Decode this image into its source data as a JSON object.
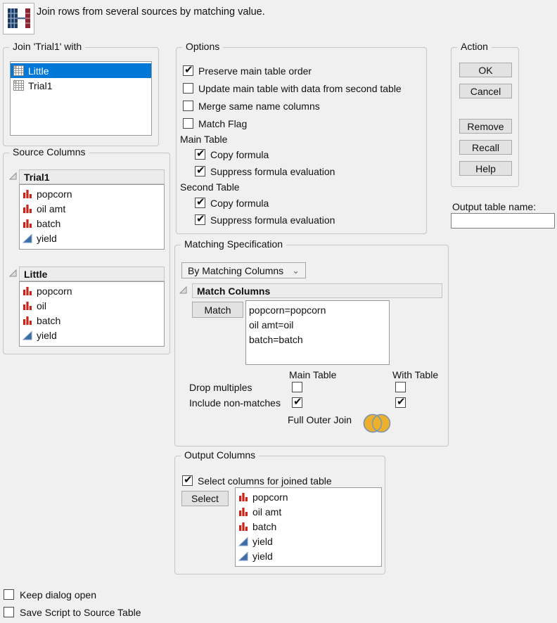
{
  "header": {
    "title": "Join rows from several sources by matching value."
  },
  "icons": {
    "chevron_down": "⌄"
  },
  "colors": {
    "sel": "#0078d7",
    "nominal": "#cb2318",
    "continuous": "#3c6da8",
    "venn": "#edb02c",
    "venn-stroke": "#7f98b2"
  },
  "join_with": {
    "label": "Join 'Trial1' with",
    "items": [
      {
        "name": "Little",
        "selected": true
      },
      {
        "name": "Trial1",
        "selected": false
      }
    ]
  },
  "source_columns": {
    "label": "Source Columns",
    "groups": [
      {
        "name": "Trial1",
        "columns": [
          {
            "name": "popcorn",
            "type": "nominal"
          },
          {
            "name": "oil amt",
            "type": "nominal"
          },
          {
            "name": "batch",
            "type": "nominal"
          },
          {
            "name": "yield",
            "type": "continuous"
          }
        ]
      },
      {
        "name": "Little",
        "columns": [
          {
            "name": "popcorn",
            "type": "nominal"
          },
          {
            "name": "oil",
            "type": "nominal"
          },
          {
            "name": "batch",
            "type": "nominal"
          },
          {
            "name": "yield",
            "type": "continuous"
          }
        ]
      }
    ]
  },
  "options": {
    "label": "Options",
    "checkboxes": [
      {
        "label": "Preserve main table order",
        "checked": true
      },
      {
        "label": "Update main table with data from second table",
        "checked": false
      },
      {
        "label": "Merge same name columns",
        "checked": false
      },
      {
        "label": "Match Flag",
        "checked": false
      }
    ],
    "main_table": {
      "label": "Main Table",
      "checkboxes": [
        {
          "label": "Copy formula",
          "checked": true
        },
        {
          "label": "Suppress formula evaluation",
          "checked": true
        }
      ]
    },
    "second_table": {
      "label": "Second Table",
      "checkboxes": [
        {
          "label": "Copy formula",
          "checked": true
        },
        {
          "label": "Suppress formula evaluation",
          "checked": true
        }
      ]
    }
  },
  "action": {
    "label": "Action",
    "buttons": [
      "OK",
      "Cancel",
      "Remove",
      "Recall",
      "Help"
    ]
  },
  "output_table": {
    "label": "Output table name:",
    "value": ""
  },
  "matching": {
    "label": "Matching Specification",
    "dropdown": "By Matching Columns",
    "match_columns_label": "Match Columns",
    "match_button": "Match",
    "pairs": [
      "popcorn=popcorn",
      "oil amt=oil",
      "batch=batch"
    ],
    "col_headers": [
      "Main Table",
      "With Table"
    ],
    "rows": [
      {
        "label": "Drop multiples",
        "main": false,
        "with": false
      },
      {
        "label": "Include non-matches",
        "main": true,
        "with": true
      }
    ],
    "join_type": "Full Outer Join"
  },
  "output_columns": {
    "label": "Output Columns",
    "select_checkbox": {
      "label": "Select columns for joined table",
      "checked": true
    },
    "select_button": "Select",
    "columns": [
      {
        "name": "popcorn",
        "type": "nominal"
      },
      {
        "name": "oil amt",
        "type": "nominal"
      },
      {
        "name": "batch",
        "type": "nominal"
      },
      {
        "name": "yield",
        "type": "continuous"
      },
      {
        "name": "yield",
        "type": "continuous"
      }
    ]
  },
  "footer": {
    "checkboxes": [
      {
        "label": "Keep dialog open",
        "checked": false
      },
      {
        "label": "Save Script to Source Table",
        "checked": false
      }
    ]
  }
}
